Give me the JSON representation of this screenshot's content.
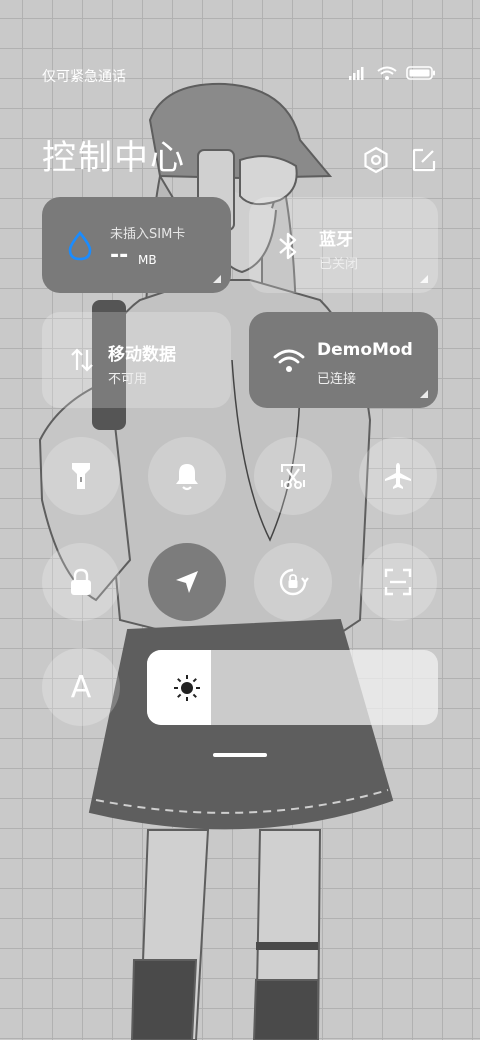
{
  "status_bar": {
    "carrier": "仅可紧急通话",
    "icons": [
      "signal-icon",
      "wifi-icon",
      "battery-icon"
    ]
  },
  "header": {
    "title": "控制中心",
    "settings_icon": "settings-hexagon-icon",
    "edit_icon": "edit-icon"
  },
  "tiles": {
    "data_usage": {
      "label": "未插入SIM卡",
      "value": "--",
      "unit": "MB",
      "icon": "water-drop-icon",
      "accent": "#1a8cff"
    },
    "bluetooth": {
      "label": "蓝牙",
      "status": "已关闭",
      "icon": "bluetooth-icon"
    },
    "mobile_data": {
      "label": "移动数据",
      "status": "不可用",
      "icon": "mobile-data-icon"
    },
    "wifi": {
      "label": "DemoMod",
      "status": "已连接",
      "icon": "wifi-icon"
    }
  },
  "toggles": [
    {
      "name": "flashlight-toggle",
      "icon": "flashlight-icon",
      "active": false
    },
    {
      "name": "ringer-toggle",
      "icon": "bell-icon",
      "active": false
    },
    {
      "name": "screenshot-toggle",
      "icon": "scissors-icon",
      "active": false
    },
    {
      "name": "airplane-toggle",
      "icon": "airplane-icon",
      "active": false
    },
    {
      "name": "lock-toggle",
      "icon": "lock-icon",
      "active": false
    },
    {
      "name": "location-toggle",
      "icon": "location-arrow-icon",
      "active": true
    },
    {
      "name": "rotation-lock-toggle",
      "icon": "rotation-lock-icon",
      "active": false
    },
    {
      "name": "scan-toggle",
      "icon": "scan-icon",
      "active": false
    }
  ],
  "bottom": {
    "auto_brightness_label": "A",
    "brightness_level": 0.22,
    "brightness_icon": "sun-icon"
  },
  "colors": {
    "active_toggle": "#7c7c7c",
    "tile_dark": "#7a7a7a"
  }
}
